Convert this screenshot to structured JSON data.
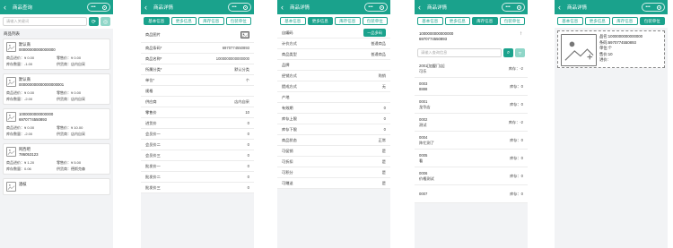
{
  "list_screen": {
    "title": "商品查询",
    "search_placeholder": "请输入关键词",
    "section_title": "商品列表",
    "items": [
      {
        "name_line1": "默认商",
        "name_line2": "00000000000000000",
        "price_in_label": "商品进价：",
        "price_in": "¥ 0.00",
        "price_out_label": "零售价：",
        "price_out": "¥ 0.00",
        "stock_label": "库存数量：",
        "stock": "-1.00",
        "supplier_label": "供货商：",
        "supplier": "店内自采"
      },
      {
        "name_line1": "默认商",
        "name_line2": "000000000000000000001",
        "price_in_label": "商品进价：",
        "price_in": "¥ 0.00",
        "price_out_label": "零售价：",
        "price_out": "¥ 0.00",
        "stock_label": "库存数量：",
        "stock": "-2.00",
        "supplier_label": "供货商：",
        "supplier": "店内自采"
      },
      {
        "name_line1": "1000000000000000",
        "name_line2": "6970774550893",
        "price_in_label": "商品进价：",
        "price_in": "¥ 0.00",
        "price_out_label": "零售价：",
        "price_out": "¥ 10.00",
        "stock_label": "库存数量：",
        "stock": "-2.00",
        "supplier_label": "供货商：",
        "supplier": "店内自采"
      },
      {
        "name_line1": "阿西吧",
        "name_line2": "786053123",
        "price_in_label": "商品进价：",
        "price_in": "¥ 1.20",
        "price_out_label": "零售价：",
        "price_out": "¥ 5.00",
        "stock_label": "库存数量：",
        "stock": "0.06",
        "supplier_label": "供货商：",
        "supplier": "德斯克森"
      },
      {
        "name_line1": "酒枝",
        "name_line2": "",
        "price_in_label": "",
        "price_in": "",
        "price_out_label": "",
        "price_out": "",
        "stock_label": "",
        "stock": "",
        "supplier_label": "",
        "supplier": ""
      }
    ]
  },
  "detail_title": "商品详情",
  "tabs": [
    "基本信息",
    "更多信息",
    "库存信息",
    "包装单位"
  ],
  "basic_screen": {
    "image_label": "商品图片",
    "rows": [
      {
        "label": "商品条码*",
        "value": "6970774550893"
      },
      {
        "label": "商品名称*",
        "value": "1000000000000000"
      },
      {
        "label": "所属分类*",
        "value": "默认分类"
      },
      {
        "label": "单位*",
        "value": "个"
      },
      {
        "label": "规格",
        "value": ""
      },
      {
        "label": "供应商",
        "value": "店内自采"
      },
      {
        "label": "零售价",
        "value": "10"
      },
      {
        "label": "进货价",
        "value": "0"
      },
      {
        "label": "会员价一",
        "value": "0"
      },
      {
        "label": "会员价二",
        "value": "0"
      },
      {
        "label": "会员价三",
        "value": "0"
      },
      {
        "label": "批发价一",
        "value": "0"
      },
      {
        "label": "批发价二",
        "value": "0"
      },
      {
        "label": "批发价三",
        "value": "0"
      }
    ]
  },
  "more_screen": {
    "rows": [
      {
        "label": "自编码",
        "value": "",
        "button": "一品多码"
      },
      {
        "label": "计价方式",
        "value": "普通商品"
      },
      {
        "label": "商品类型",
        "value": "普通商品"
      },
      {
        "label": "品牌",
        "value": ""
      },
      {
        "label": "经销方式",
        "value": "购销"
      },
      {
        "label": "提成方式",
        "value": "无"
      },
      {
        "label": "产地",
        "value": ""
      },
      {
        "label": "有效期",
        "value": "0"
      },
      {
        "label": "库存上限",
        "value": "0"
      },
      {
        "label": "库存下限",
        "value": "0"
      },
      {
        "label": "商品状态",
        "value": "正常"
      },
      {
        "label": "可促销",
        "value": "是"
      },
      {
        "label": "可折扣",
        "value": "是"
      },
      {
        "label": "可积分",
        "value": "是"
      },
      {
        "label": "可赠送",
        "value": "是"
      }
    ]
  },
  "stock_screen": {
    "code_line1": "1000000000000000",
    "code_line2": "6970774550893",
    "search_placeholder": "请输入查询信息",
    "items": [
      {
        "line1": "2001[加盟门店]",
        "line2": "可乐",
        "stock": "库存：-2"
      },
      {
        "line1": "0003",
        "line2": "8888",
        "stock": "库存：0"
      },
      {
        "line1": "0001",
        "line2": "龙华店",
        "stock": "库存：0"
      },
      {
        "line1": "0002",
        "line2": "测试",
        "stock": "库存：-2"
      },
      {
        "line1": "0004",
        "line2": "阵忙测了",
        "stock": "库存：0"
      },
      {
        "line1": "0005",
        "line2": "看",
        "stock": "库存：0"
      },
      {
        "line1": "0006",
        "line2": "价格测试",
        "stock": "库存：0"
      },
      {
        "line1": "0007",
        "line2": "",
        "stock": "库存：0"
      }
    ]
  },
  "unit_screen": {
    "fields": [
      "条码:6970774550893",
      "单位:个",
      "售价:10",
      "进价:"
    ],
    "name_field": "品名:1000000000000000"
  },
  "colors": {
    "accent": "#1aa28c",
    "accent_light": "#8fd6c8",
    "background": "#f2f3f5"
  },
  "icons": {
    "back": "chevron-left-icon",
    "more": "more-dots-icon",
    "record": "record-icon",
    "search": "search-icon",
    "refresh": "refresh-icon",
    "image": "image-placeholder-icon",
    "filter": "filter-icon"
  }
}
